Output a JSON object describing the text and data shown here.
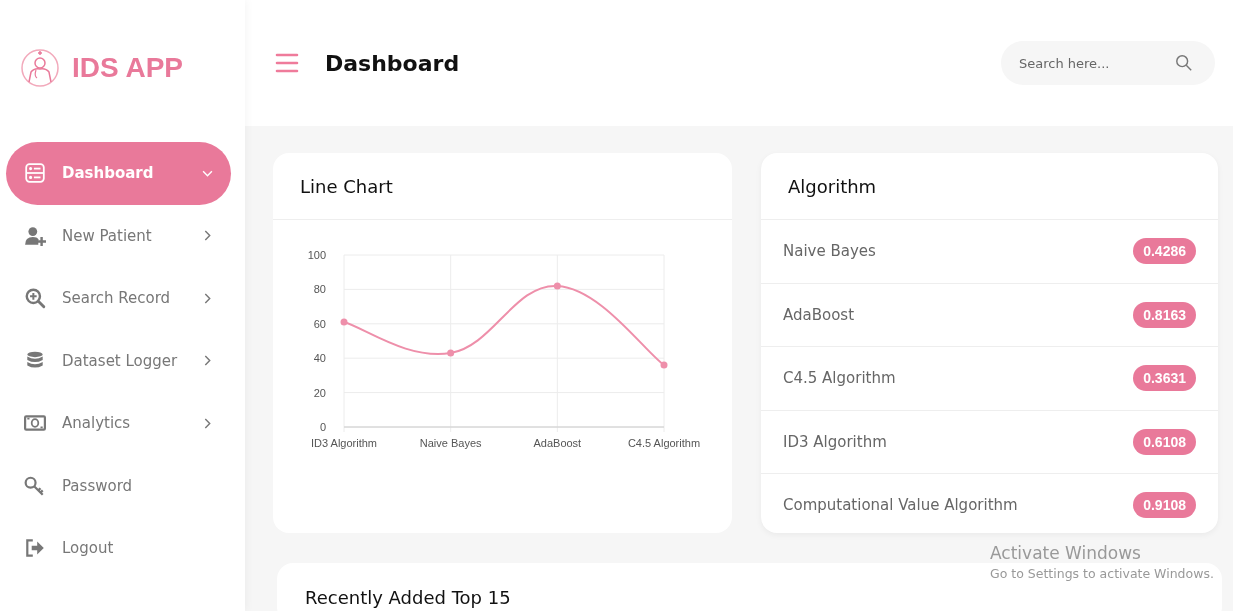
{
  "sidebar": {
    "brand": "IDS APP",
    "items": [
      {
        "label": "Dashboard",
        "selected": true,
        "expandable": true
      },
      {
        "label": "New Patient",
        "selected": false,
        "expandable": true
      },
      {
        "label": "Search Record",
        "selected": false,
        "expandable": true
      },
      {
        "label": "Dataset Logger",
        "selected": false,
        "expandable": true
      },
      {
        "label": "Analytics",
        "selected": false,
        "expandable": true
      },
      {
        "label": "Password",
        "selected": false,
        "expandable": false
      },
      {
        "label": "Logout",
        "selected": false,
        "expandable": false
      }
    ]
  },
  "header": {
    "title": "Dashboard",
    "search": {
      "placeholder": "Search here..."
    }
  },
  "line_chart": {
    "title": "Line Chart",
    "chart_data": {
      "type": "line",
      "categories": [
        "ID3 Algorithm",
        "Naive Bayes",
        "AdaBoost",
        "C4.5 Algorithm"
      ],
      "series": [
        {
          "color": "#ee8faa",
          "marker": true,
          "values": [
            61,
            43,
            82,
            36
          ]
        }
      ],
      "ylim": [
        0,
        100
      ],
      "yticks": [
        0,
        20,
        40,
        60,
        80,
        100
      ],
      "grid": true
    }
  },
  "algorithm": {
    "title": "Algorithm",
    "rows": [
      {
        "name": "Naive Bayes",
        "score": "0.4286"
      },
      {
        "name": "AdaBoost",
        "score": "0.8163"
      },
      {
        "name": "C4.5 Algorithm",
        "score": "0.3631"
      },
      {
        "name": "ID3 Algorithm",
        "score": "0.6108"
      },
      {
        "name": "Computational Value Algorithm",
        "score": "0.9108"
      }
    ]
  },
  "recent": {
    "title": "Recently Added Top 15"
  },
  "activation_notice": {
    "title": "Activate Windows",
    "subtitle": "Go to Settings to activate Windows."
  }
}
